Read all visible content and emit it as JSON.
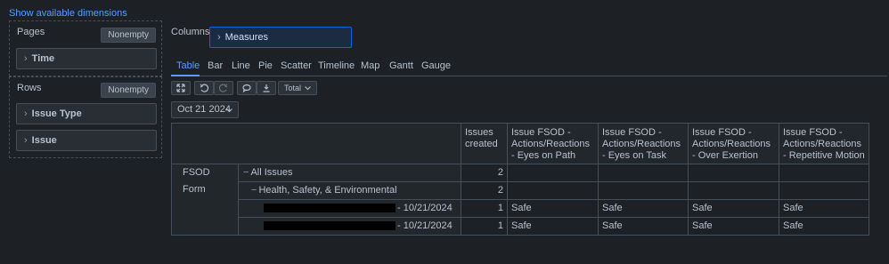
{
  "show_dims_link": "Show available dimensions",
  "pages": {
    "title": "Pages",
    "nonempty": "Nonempty",
    "dims": [
      "Time"
    ]
  },
  "rows": {
    "title": "Rows",
    "nonempty": "Nonempty",
    "dims": [
      "Issue Type",
      "Issue"
    ]
  },
  "columns": {
    "title": "Columns",
    "measures": "Measures"
  },
  "tabs": [
    "Table",
    "Bar",
    "Line",
    "Pie",
    "Scatter",
    "Timeline",
    "Map",
    "Gantt",
    "Gauge"
  ],
  "active_tab": "Table",
  "toolbar": {
    "total_label": "Total"
  },
  "date_filter": "Oct 21 2024",
  "table": {
    "corner_label": "",
    "headers": [
      "Issues created",
      "Issue FSOD - Actions/Reactions - Eyes on Path",
      "Issue FSOD - Actions/Reactions - Eyes on Task",
      "Issue FSOD - Actions/Reactions - Over Exertion",
      "Issue FSOD - Actions/Reactions - Repetitive Motion"
    ],
    "row_group": "FSOD Form",
    "rows": [
      {
        "label": "All Issues",
        "issues": "2",
        "c1": "",
        "c2": "",
        "c3": "",
        "c4": ""
      },
      {
        "label": "Health, Safety, & Environmental",
        "issues": "2",
        "c1": "",
        "c2": "",
        "c3": "",
        "c4": ""
      },
      {
        "label": "- 10/21/2024",
        "issues": "1",
        "c1": "Safe",
        "c2": "Safe",
        "c3": "Safe",
        "c4": "Safe"
      },
      {
        "label": "- 10/21/2024",
        "issues": "1",
        "c1": "Safe",
        "c2": "Safe",
        "c3": "Safe",
        "c4": "Safe"
      }
    ]
  }
}
